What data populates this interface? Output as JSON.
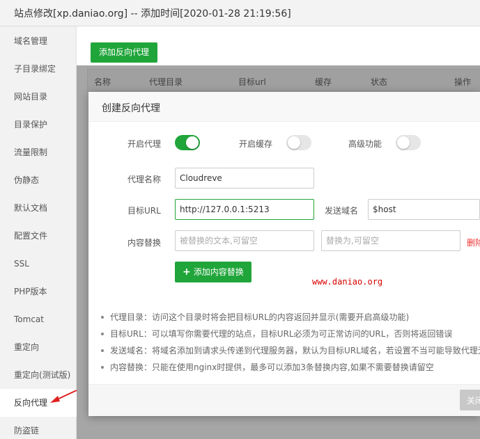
{
  "window": {
    "title": "站点修改[xp.daniao.org] -- 添加时间[2020-01-28 21:19:56]"
  },
  "sidebar": {
    "items": [
      {
        "label": "域名管理"
      },
      {
        "label": "子目录绑定"
      },
      {
        "label": "网站目录"
      },
      {
        "label": "目录保护"
      },
      {
        "label": "流量限制"
      },
      {
        "label": "伪静态"
      },
      {
        "label": "默认文档"
      },
      {
        "label": "配置文件"
      },
      {
        "label": "SSL"
      },
      {
        "label": "PHP版本"
      },
      {
        "label": "Tomcat"
      },
      {
        "label": "重定向"
      },
      {
        "label": "重定向(测试版)"
      },
      {
        "label": "反向代理"
      },
      {
        "label": "防盗链"
      }
    ],
    "active_label": "反向代理"
  },
  "main": {
    "add_button": "添加反向代理",
    "columns": [
      "名称",
      "代理目录",
      "目标url",
      "缓存",
      "状态",
      "操作"
    ]
  },
  "dialog": {
    "title": "创建反向代理",
    "toggles": [
      {
        "label": "开启代理",
        "on": true
      },
      {
        "label": "开启缓存",
        "on": false
      },
      {
        "label": "高级功能",
        "on": false
      }
    ],
    "proxy_name": {
      "label": "代理名称",
      "value": "Cloudreve"
    },
    "target_url": {
      "label": "目标URL",
      "value": "http://127.0.0.1:5213"
    },
    "send_domain": {
      "label": "发送域名",
      "value": "$host"
    },
    "content_replace": {
      "label": "内容替换",
      "from_placeholder": "被替换的文本,可留空",
      "to_placeholder": "替换为,可留空",
      "delete_label": "删除"
    },
    "add_replace_button": "添加内容替换",
    "watermark": "www.daniao.org",
    "tips": [
      "代理目录：访问这个目录时将会把目标URL的内容返回并显示(需要开启高级功能)",
      "目标URL：可以填写你需要代理的站点，目标URL必须为可正常访问的URL，否则将返回错误",
      "发送域名：将域名添加到请求头传递到代理服务器，默认为目标URL域名，若设置不当可能导致代理无法正常运行",
      "内容替换：只能在使用nginx时提供，最多可以添加3条替换内容,如果不需要替换请留空"
    ],
    "close_button": "关闭"
  },
  "colors": {
    "accent": "#20a53a",
    "danger": "#e33333",
    "annotation": "#d80000"
  }
}
